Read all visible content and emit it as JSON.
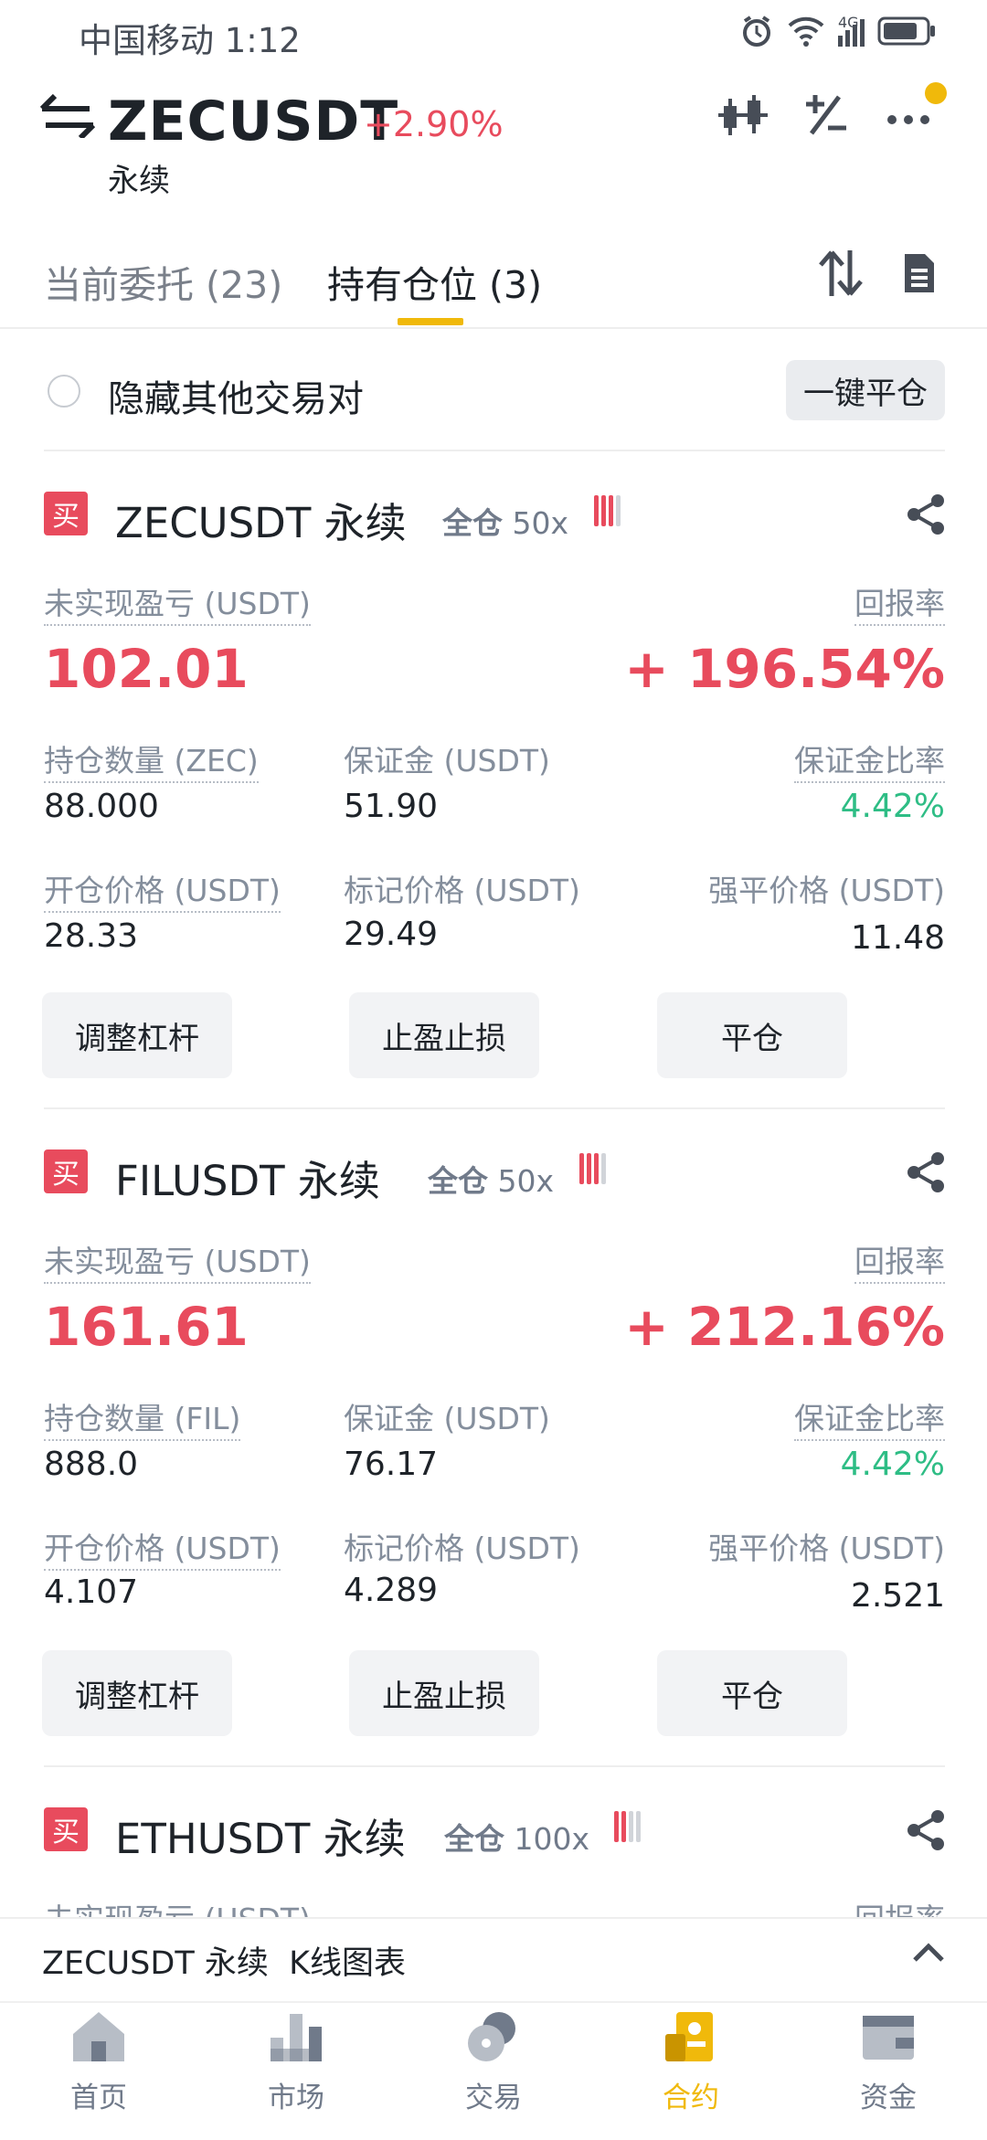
{
  "status_bar": {
    "carrier_time": "中国移动 1:12",
    "network": "4G"
  },
  "header": {
    "symbol": "ZECUSDT",
    "change": "+2.90%",
    "subtitle": "永续",
    "icons": [
      "swap-arrows-icon",
      "candlestick-icon",
      "plus-minus-icon",
      "more-icon"
    ]
  },
  "tabs": [
    {
      "label": "当前委托 (23)",
      "active": false
    },
    {
      "label": "持有仓位 (3)",
      "active": true
    }
  ],
  "filter": {
    "hide_label": "隐藏其他交易对",
    "close_all": "一键平仓"
  },
  "labels": {
    "unrealized_pnl": "未实现盈亏 (USDT)",
    "roe": "回报率",
    "margin": "保证金 (USDT)",
    "margin_ratio": "保证金比率",
    "entry_price": "开仓价格 (USDT)",
    "mark_price": "标记价格 (USDT)",
    "liq_price": "强平价格 (USDT)",
    "adjust_leverage": "调整杠杆",
    "tp_sl": "止盈止损",
    "close": "平仓",
    "buy": "买"
  },
  "positions": [
    {
      "symbol": "ZECUSDT 永续",
      "margin_mode": "全仓",
      "leverage": "50x",
      "risk_level": 3,
      "pnl": "102.01",
      "roe": "+ 196.54%",
      "qty_label": "持仓数量 (ZEC)",
      "qty": "88.000",
      "margin": "51.90",
      "margin_ratio": "4.42%",
      "entry_price": "28.33",
      "mark_price": "29.49",
      "liq_price": "11.48"
    },
    {
      "symbol": "FILUSDT 永续",
      "margin_mode": "全仓",
      "leverage": "50x",
      "risk_level": 3,
      "pnl": "161.61",
      "roe": "+ 212.16%",
      "qty_label": "持仓数量 (FIL)",
      "qty": "888.0",
      "margin": "76.17",
      "margin_ratio": "4.42%",
      "entry_price": "4.107",
      "mark_price": "4.289",
      "liq_price": "2.521"
    },
    {
      "symbol": "ETHUSDT 永续",
      "margin_mode": "全仓",
      "leverage": "100x",
      "risk_level": 2,
      "pnl_label_partial": "未实现盈亏 (USDT)",
      "roe_label_partial": "回报率"
    }
  ],
  "kline_bar": {
    "label": "ZECUSDT 永续  K线图表"
  },
  "bottom_nav": [
    {
      "label": "首页",
      "icon": "home-icon",
      "active": false
    },
    {
      "label": "市场",
      "icon": "market-icon",
      "active": false
    },
    {
      "label": "交易",
      "icon": "trade-icon",
      "active": false
    },
    {
      "label": "合约",
      "icon": "futures-icon",
      "active": true
    },
    {
      "label": "资金",
      "icon": "wallet-icon",
      "active": false
    }
  ],
  "colors": {
    "up": "#e84b5d",
    "green": "#2ebd85",
    "accent": "#f0b90b",
    "muted": "#848e9c"
  }
}
